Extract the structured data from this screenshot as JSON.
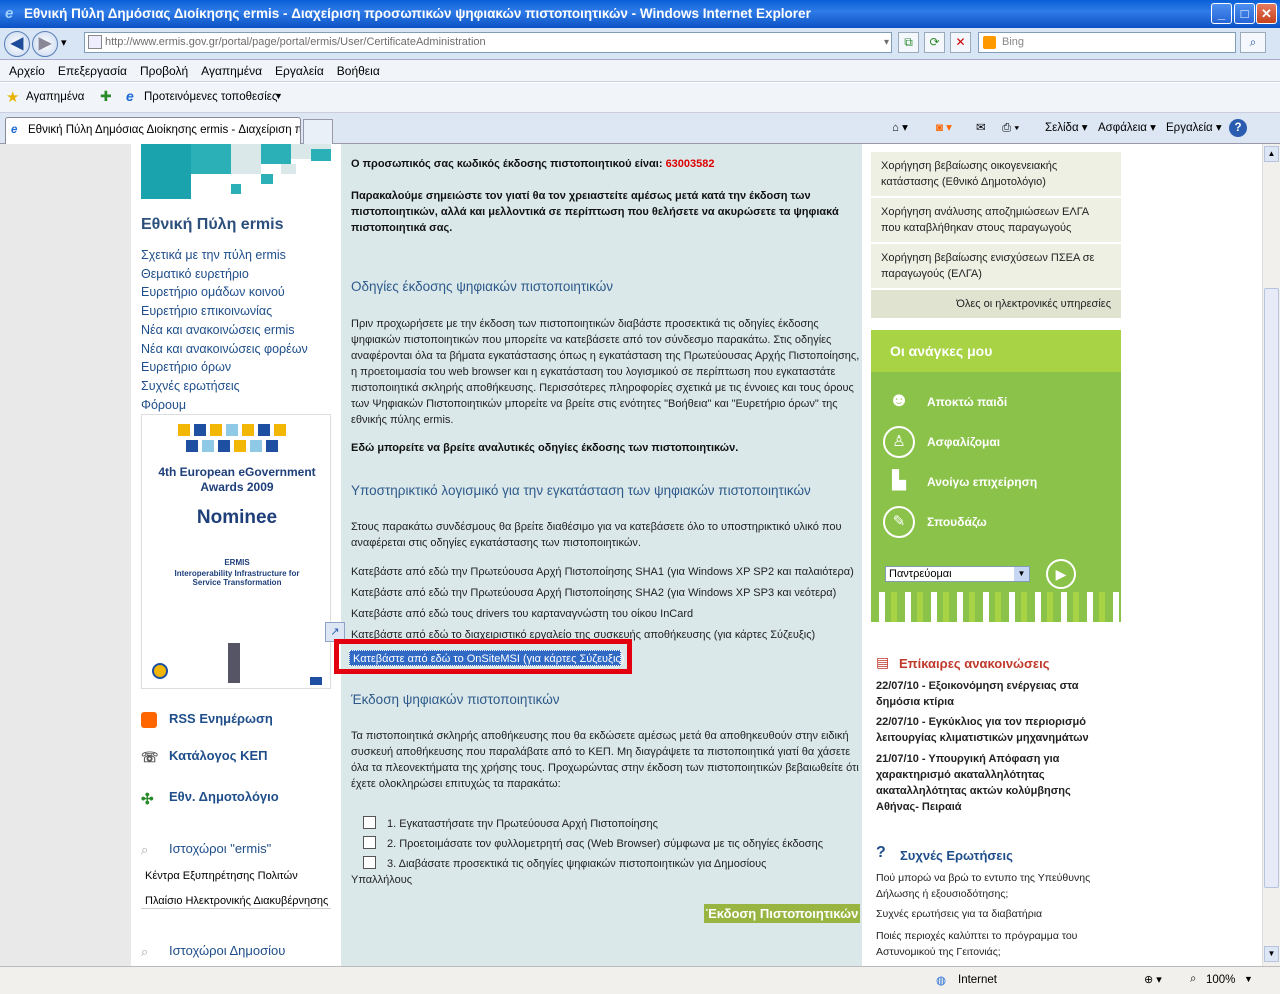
{
  "window": {
    "title": "Εθνική Πύλη Δημόσιας Διοίκησης ermis - Διαχείριση προσωπικών ψηφιακών πιστοποιητικών - Windows Internet Explorer",
    "minimize": "_",
    "maximize": "□",
    "close": "✕"
  },
  "nav": {
    "back": "◀",
    "forward": "▶",
    "dropdown": "▾",
    "url": "http://www.ermis.gov.gr/portal/page/portal/ermis/User/CertificateAdministration",
    "search_placeholder": "Bing",
    "refresh": "⟳",
    "stop": "✕",
    "compat": "⧉",
    "search_btn": "⌕"
  },
  "menu": [
    "Αρχείο",
    "Επεξεργασία",
    "Προβολή",
    "Αγαπημένα",
    "Εργαλεία",
    "Βοήθεια"
  ],
  "favorites": {
    "label": "Αγαπημένα",
    "suggested": "Προτεινόμενες τοποθεσίες"
  },
  "tab": {
    "title": "Εθνική Πύλη Δημόσιας Διοίκησης ermis - Διαχείριση πρ...",
    "page": "Σελίδα",
    "safety": "Ασφάλεια",
    "tools": "Εργαλεία",
    "help": "?"
  },
  "left": {
    "title": "Εθνική Πύλη ermis",
    "links": [
      "Σχετικά με την πύλη ermis",
      "Θεματικό ευρετήριο",
      "Ευρετήριο ομάδων κοινού",
      "Ευρετήριο επικοινωνίας",
      "Νέα και ανακοινώσεις ermis",
      "Νέα και ανακοινώσεις φορέων",
      "Ευρετήριο όρων",
      "Συχνές ερωτήσεις",
      "Φόρουμ"
    ],
    "award": {
      "line1": "4th European eGovernment",
      "line2": "Awards 2009",
      "nominee": "Nominee",
      "ermis": "ERMIS",
      "desc": "Interoperability Infrastructure for Service Transformation"
    },
    "rss": "RSS Ενημέρωση",
    "kep": "Κατάλογος ΚΕΠ",
    "dimotologio": "Εθν. Δημοτολόγιο",
    "sites_title": "Ιστοχώροι \"ermis\"",
    "sites": [
      "Κέντρα Εξυπηρέτησης Πολιτών",
      "Πλαίσιο Ηλεκτρονικής Διακυβέρνησης"
    ],
    "public_sites": "Ιστοχώροι Δημοσίου"
  },
  "center": {
    "code_label": "Ο προσωπικός σας κωδικός έκδοσης πιστοποιητικού είναι:",
    "code_value": "63003582",
    "note": "Παρακαλούμε σημειώστε τον γιατί θα τον χρειαστείτε αμέσως μετά κατά την έκδοση των πιστοποιητικών, αλλά και μελλοντικά σε περίπτωση που θελήσετε να ακυρώσετε τα ψηφιακά πιστοποιητικά σας.",
    "h1": "Οδηγίες έκδοσης ψηφιακών πιστοποιητικών",
    "p1": "Πριν προχωρήσετε με την έκδοση των πιστοποιητικών διαβάστε προσεκτικά τις οδηγίες έκδοσης ψηφιακών πιστοποιητικών που μπορείτε να κατεβάσετε από τον σύνδεσμο παρακάτω. Στις οδηγίες αναφέρονται όλα τα βήματα εγκατάστασης όπως η εγκατάσταση της Πρωτεύουσας Αρχής Πιστοποίησης, η προετοιμασία του web browser και η εγκατάσταση του λογισμικού σε περίπτωση που εγκαταστάτε πιστοποιητικά σκληρής αποθήκευσης. Περισσότερες πληροφορίες σχετικά με τις έννοιες και τους όρους των Ψηφιακών Πιστοποιητικών μπορείτε να βρείτε στις ενότητες \"Βοήθεια\" και \"Ευρετήριο όρων\" της εθνικής πύλης ermis.",
    "p2": "Εδώ μπορείτε να βρείτε αναλυτικές οδηγίες έκδοσης των πιστοποιητικών.",
    "h2": "Υποστηρικτικό λογισμικό για την εγκατάσταση των ψηφιακών πιστοποιητικών",
    "p3": "Στους παρακάτω συνδέσμους θα βρείτε διαθέσιμο για να κατεβάσετε όλο το υποστηρικτικό υλικό που αναφέρεται στις οδηγίες εγκατάστασης των πιστοποιητικών.",
    "downloads": [
      "Κατεβάστε από εδώ την Πρωτεύουσα Αρχή Πιστοποίησης SHA1 (για Windows XP SP2 και παλαιότερα)",
      "Κατεβάστε από εδώ την Πρωτεύουσα Αρχή Πιστοποίησης SHA2 (για Windows XP SP3 και νεότερα)",
      "Κατεβάστε από εδώ τους drivers του καρταναγνώστη του οίκου InCard",
      "Κατεβάστε από εδώ το διαχειριστικό εργαλείο της συσκευής αποθήκευσης (για κάρτες Σύζευξις)"
    ],
    "highlighted": "Κατεβάστε από εδώ το OnSiteMSI (για κάρτες Σύζευξις)",
    "h3": "Έκδοση ψηφιακών πιστοποιητικών",
    "p4": "Τα πιστοποιητικά σκληρής αποθήκευσης που θα εκδώσετε αμέσως μετά θα αποθηκευθούν στην ειδική συσκευή αποθήκευσης που παραλάβατε από το ΚΕΠ. Μη διαγράψετε τα πιστοποιητικά γιατί θα χάσετε όλα τα πλεονεκτήματα της χρήσης τους. Προχωρώντας στην έκδοση των πιστοποιητικών βεβαιωθείτε ότι έχετε ολοκληρώσει επιτυχώς τα παρακάτω:",
    "checks": [
      "1. Εγκαταστήσατε την Πρωτεύουσα Αρχή Πιστοποίησης",
      "2. Προετοιμάσατε τον φυλλομετρητή σας (Web Browser) σύμφωνα με τις οδηγίες έκδοσης",
      "3. Διαβάσατε προσεκτικά τις οδηγίες ψηφιακών πιστοποιητικών για Δημοσίους"
    ],
    "check3_cont": "Υπαλλήλους",
    "issue_button": "Έκδοση Πιστοποιητικών"
  },
  "right": {
    "services": [
      "Χορήγηση βεβαίωσης οικογενειακής κατάστασης (Εθνικό Δημοτολόγιο)",
      "Χορήγηση ανάλυσης αποζημιώσεων ΕΛΓΑ που καταβλήθηκαν στους παραγωγούς",
      "Χορήγηση βεβαίωσης ενισχύσεων ΠΣΕΑ σε παραγωγούς (ΕΛΓΑ)"
    ],
    "all_services": "Όλες οι ηλεκτρονικές υπηρεσίες",
    "needs_title": "Οι ανάγκες μου",
    "needs": [
      "Αποκτώ παιδί",
      "Ασφαλίζομαι",
      "Ανοίγω επιχείρηση",
      "Σπουδάζω"
    ],
    "needs_select": "Παντρεύομαι",
    "news_title": "Επίκαιρες ανακοινώσεις",
    "news": [
      "22/07/10 - Εξοικονόμηση ενέργειας στα δημόσια κτίρια",
      "22/07/10 - Εγκύκλιος για τον περιορισμό λειτουργίας κλιματιστικών μηχανημάτων",
      "21/07/10 - Υπουργική Απόφαση για χαρακτηρισμό ακαταλληλότητας ακαταλληλότητας ακτών κολύμβησης Αθήνας- Πειραιά"
    ],
    "faq_title": "Συχνές Ερωτήσεις",
    "faq": [
      "Πού μπορώ να βρώ το εντυπο της Υπεύθυνης Δήλωσης ή εξουσιοδότησης;",
      "Συχνές ερωτήσεις για τα διαβατήρια",
      "Ποιές περιοχές καλύπτει το πρόγραμμα του Αστυνομικού της Γειτονιάς;"
    ]
  },
  "status": {
    "zone": "Internet",
    "zoom": "100%"
  },
  "colors": {
    "title_bar": "#0a5fd6",
    "center_bg": "#dbe8ea",
    "accent_green": "#8bc34a",
    "highlight": "#316ac5",
    "red_box": "#e3000f"
  }
}
